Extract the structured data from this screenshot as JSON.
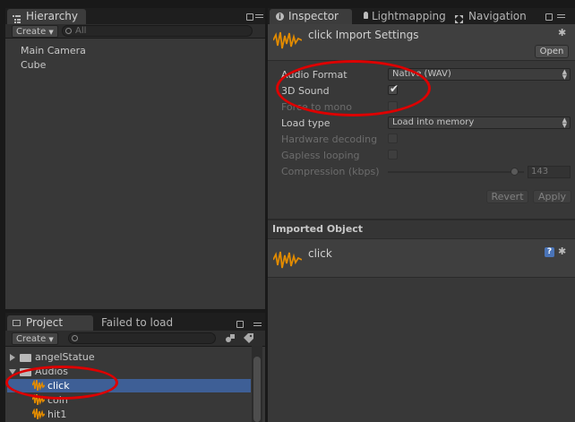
{
  "hierarchy": {
    "tab_label": "Hierarchy",
    "create_label": "Create",
    "search_placeholder": "All",
    "items": [
      "Main Camera",
      "Cube"
    ]
  },
  "project": {
    "tab_label": "Project",
    "tab2_label": "Failed to load",
    "create_label": "Create",
    "search_placeholder": "",
    "tree": [
      {
        "label": "angelStatue"
      },
      {
        "label": "Audios"
      },
      {
        "label": "click",
        "selected": true
      },
      {
        "label": "coin"
      },
      {
        "label": "hit1"
      }
    ]
  },
  "inspector": {
    "tabs": [
      "Inspector",
      "Lightmapping",
      "Navigation"
    ],
    "title": "click Import Settings",
    "open_label": "Open",
    "fields": {
      "audio_format": {
        "label": "Audio Format",
        "value": "Native (WAV)"
      },
      "sound_3d": {
        "label": "3D Sound",
        "checked": true
      },
      "force_mono": {
        "label": "Force to mono",
        "checked": false
      },
      "load_type": {
        "label": "Load type",
        "value": "Load into memory"
      },
      "hardware_decoding": {
        "label": "Hardware decoding",
        "checked": false
      },
      "gapless_looping": {
        "label": "Gapless looping",
        "checked": false
      },
      "compression": {
        "label": "Compression (kbps)",
        "value": "143",
        "slider_fraction": 0.93
      }
    },
    "revert_label": "Revert",
    "apply_label": "Apply",
    "imported_object_label": "Imported Object",
    "imported_name": "click"
  },
  "colors": {
    "selection": "#3e5f96",
    "annotation_ring": "#dd0000",
    "audio_icon": "#e08a00"
  }
}
